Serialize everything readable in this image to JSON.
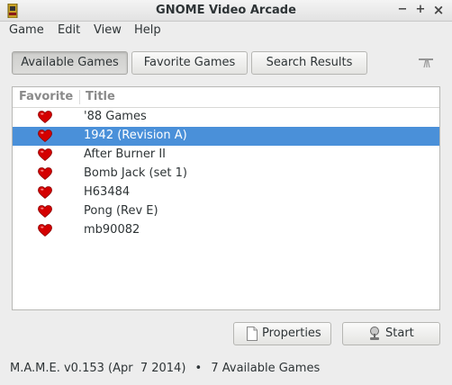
{
  "window": {
    "title": "GNOME Video Arcade",
    "minimize_label": "−",
    "maximize_label": "+",
    "close_label": "×"
  },
  "menubar": {
    "items": [
      "Game",
      "Edit",
      "View",
      "Help"
    ]
  },
  "view_tabs": {
    "available": "Available Games",
    "favorite": "Favorite Games",
    "search": "Search Results",
    "active": "Available Games"
  },
  "toolbar": {
    "icon": "broom-icon"
  },
  "game_list": {
    "columns": [
      "Favorite",
      "Title"
    ],
    "rows": [
      {
        "title": "'88 Games",
        "favorite": true,
        "selected": false
      },
      {
        "title": "1942 (Revision A)",
        "favorite": true,
        "selected": true
      },
      {
        "title": "After Burner II",
        "favorite": true,
        "selected": false
      },
      {
        "title": "Bomb Jack (set 1)",
        "favorite": true,
        "selected": false
      },
      {
        "title": "H63484",
        "favorite": true,
        "selected": false
      },
      {
        "title": "Pong (Rev E)",
        "favorite": true,
        "selected": false
      },
      {
        "title": "mb90082",
        "favorite": true,
        "selected": false
      }
    ]
  },
  "buttons": {
    "properties": "Properties",
    "start": "Start"
  },
  "status": {
    "version": "M.A.M.E. v0.153 (Apr  7 2014)",
    "separator": "•",
    "count": "7 Available Games"
  },
  "colors": {
    "selection": "#4a90d9",
    "heart": "#d40000",
    "window_bg": "#ededed"
  }
}
